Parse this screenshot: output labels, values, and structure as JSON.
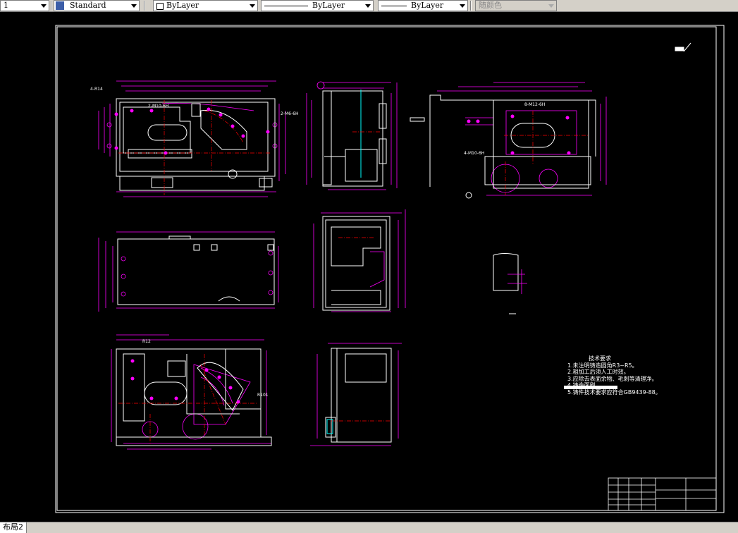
{
  "toolbar": {
    "layer_value": "1",
    "textstyle_value": "Standard",
    "color_value": "ByLayer",
    "linetype_value": "ByLayer",
    "lineweight_value": "ByLayer",
    "plotstyle_value": "随颜色"
  },
  "drawing": {
    "notes_title": "技术要求",
    "notes": [
      "1.未注明铸造圆角R3~R5。",
      "2.粗加工后须人工时效。",
      "3.应除去表面余物、毛刺等清理净。",
      "4.铸造面刷",
      "5.铸件技术要求应符合GB9439-88。"
    ],
    "labels": {
      "holes_top_a": "2-M10-6H",
      "holes_top_b": "2-M6-6H",
      "fillet": "4-R14",
      "holes_right_a": "8-M12-6H",
      "holes_right_b": "4-M10-6H",
      "radius_c": "R12",
      "radius_d": "R101"
    }
  },
  "statusbar": {
    "layout_tab": "布局2"
  },
  "colors": {
    "canvas": "#000000",
    "geometry": "#ffffff",
    "dimension": "#ff00ff",
    "center": "#ff0000",
    "hidden": "#00ffff"
  }
}
